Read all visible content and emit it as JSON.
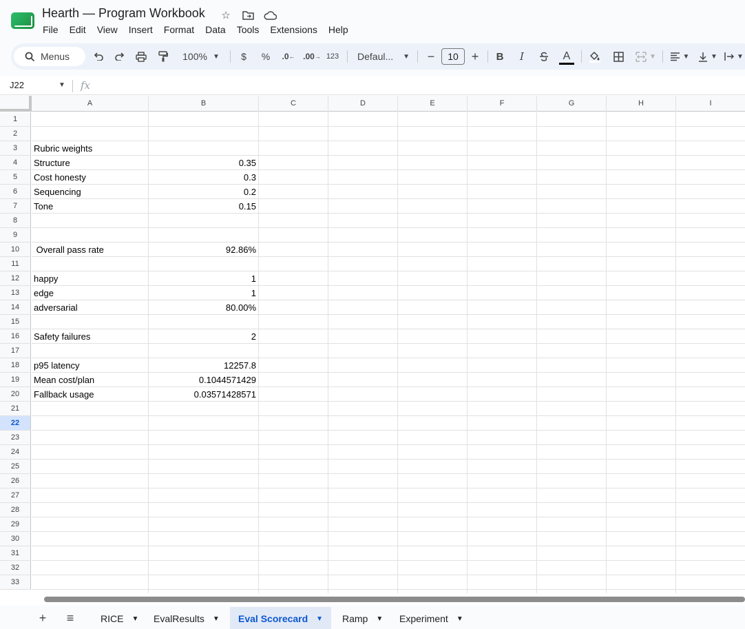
{
  "app": {
    "title": "Hearth — Program Workbook",
    "menu": [
      "File",
      "Edit",
      "View",
      "Insert",
      "Format",
      "Data",
      "Tools",
      "Extensions",
      "Help"
    ]
  },
  "toolbar": {
    "search_label": "Menus",
    "zoom": "100%",
    "currency": "$",
    "percent": "%",
    "decrease_decimal": ".0",
    "increase_decimal": ".00",
    "number_format": "123",
    "font": "Defaul...",
    "font_size": "10",
    "minus": "−",
    "plus": "+",
    "bold": "B",
    "italic": "I",
    "text_color": "A"
  },
  "formula_bar": {
    "cell_ref": "J22",
    "fx": "fx",
    "formula": ""
  },
  "columns": [
    "A",
    "B",
    "C",
    "D",
    "E",
    "F",
    "G",
    "H",
    "I"
  ],
  "rows": [
    "1",
    "2",
    "3",
    "4",
    "5",
    "6",
    "7",
    "8",
    "9",
    "10",
    "11",
    "12",
    "13",
    "14",
    "15",
    "16",
    "17",
    "18",
    "19",
    "20",
    "21",
    "22",
    "23",
    "24",
    "25",
    "26",
    "27",
    "28",
    "29",
    "30",
    "31",
    "32",
    "33"
  ],
  "selected_row": "22",
  "cells": {
    "r3a": "Rubric weights",
    "r4a": "Structure",
    "r4b": "0.35",
    "r5a": "Cost honesty",
    "r5b": "0.3",
    "r6a": "Sequencing",
    "r6b": "0.2",
    "r7a": "Tone",
    "r7b": "0.15",
    "r10a": " Overall pass rate",
    "r10b": "92.86%",
    "r12a": "happy",
    "r12b": "1",
    "r13a": "edge",
    "r13b": "1",
    "r14a": "adversarial",
    "r14b": "80.00%",
    "r16a": "Safety failures",
    "r16b": "2",
    "r18a": "p95 latency",
    "r18b": "12257.8",
    "r19a": "Mean cost/plan",
    "r19b": "0.1044571429",
    "r20a": "Fallback usage",
    "r20b": "0.03571428571"
  },
  "sheets": {
    "add": "+",
    "all": "≡",
    "tabs": [
      "RICE",
      "EvalResults",
      "Eval Scorecard",
      "Ramp",
      "Experiment"
    ],
    "active": "Eval Scorecard"
  }
}
